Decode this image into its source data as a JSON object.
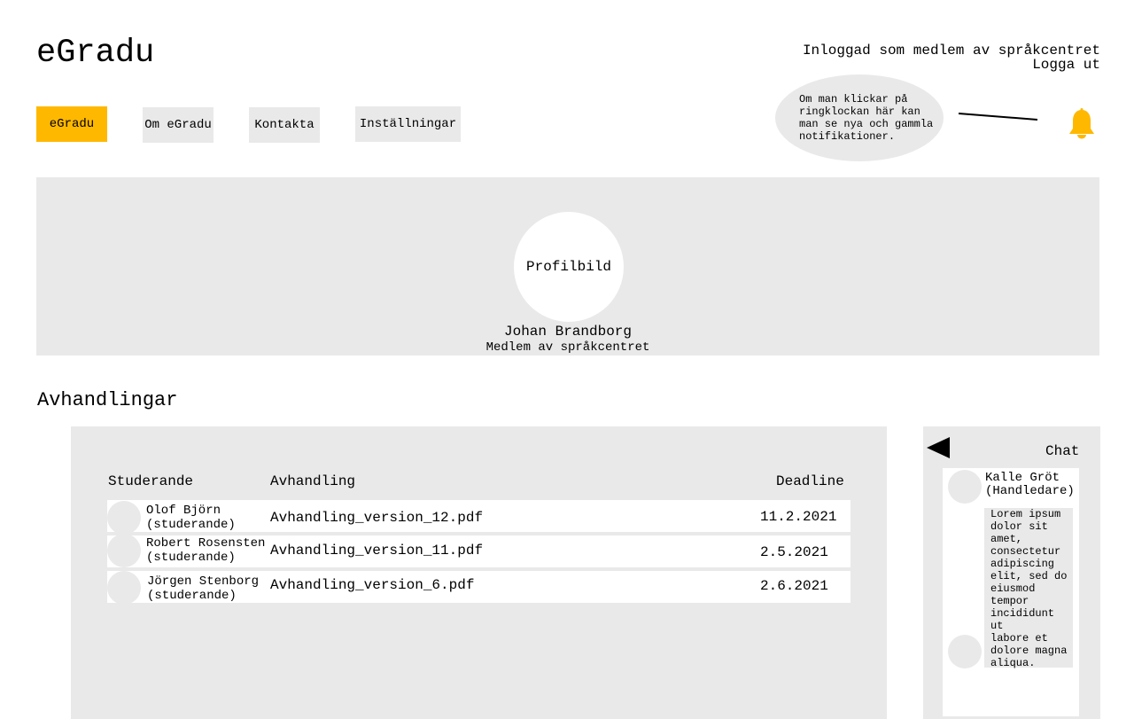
{
  "header": {
    "logo": "eGradu",
    "logged_in_as": "Inloggad som medlem av språkcentret",
    "logout": "Logga ut"
  },
  "nav": {
    "items": [
      {
        "label": "eGradu",
        "active": true
      },
      {
        "label": "Om eGradu",
        "active": false
      },
      {
        "label": "Kontakta",
        "active": false
      },
      {
        "label": "Inställningar",
        "active": false
      }
    ]
  },
  "notification_tip": "Om man klickar på ringklockan här kan man se nya och gammla notifikationer.",
  "icons": {
    "bell": "bell-icon",
    "chat_toggle": "triangle-left-icon"
  },
  "colors": {
    "accent": "#ffb800",
    "panel": "#e9e9e9"
  },
  "profile": {
    "picture_label": "Profilbild",
    "name": "Johan Brandborg",
    "role": "Medlem av språkcentret"
  },
  "theses": {
    "title": "Avhandlingar",
    "columns": [
      "Studerande",
      "Avhandling",
      "Deadline"
    ],
    "rows": [
      {
        "student": "Olof Björn",
        "student_role": "(studerande)",
        "file": "Avhandling_version_12.pdf",
        "deadline": "11.2.2021"
      },
      {
        "student": "Robert Rosensten",
        "student_role": "(studerande)",
        "file": "Avhandling_version_11.pdf",
        "deadline": "2.5.2021"
      },
      {
        "student": "Jörgen Stenborg",
        "student_role": "(studerande)",
        "file": "Avhandling_version_6.pdf",
        "deadline": "2.6.2021"
      }
    ]
  },
  "chat": {
    "title": "Chat",
    "sender_name": "Kalle Gröt",
    "sender_role": "(Handledare)",
    "message": "Lorem ipsum\ndolor sit\namet,\nconsectetur\nadipiscing\nelit, sed do\neiusmod\ntempor\nincididunt ut\nlabore et\ndolore magna\naliqua."
  }
}
